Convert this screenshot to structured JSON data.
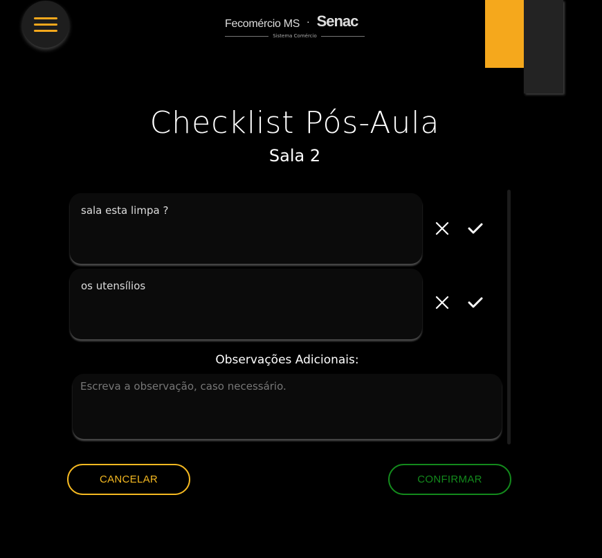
{
  "header": {
    "logo_left": "Fecomércio MS",
    "logo_separator": "·",
    "logo_right": "Senac",
    "logo_sub": "Sistema Comércio"
  },
  "page": {
    "title": "Checklist Pós-Aula",
    "subtitle": "Sala 2"
  },
  "checklist": {
    "items": [
      {
        "label": "sala esta limpa ?"
      },
      {
        "label": "os utensílios"
      }
    ]
  },
  "observations": {
    "label": "Observações Adicionais:",
    "placeholder": "Escreva a observação, caso necessário.",
    "value": ""
  },
  "actions": {
    "cancel_label": "CANCELAR",
    "confirm_label": "CONFIRMAR"
  },
  "colors": {
    "accent": "#f5a81c",
    "confirm": "#138a1c",
    "background": "#000000"
  },
  "icons": {
    "menu": "hamburger-icon",
    "reject": "close-icon",
    "approve": "check-icon"
  }
}
